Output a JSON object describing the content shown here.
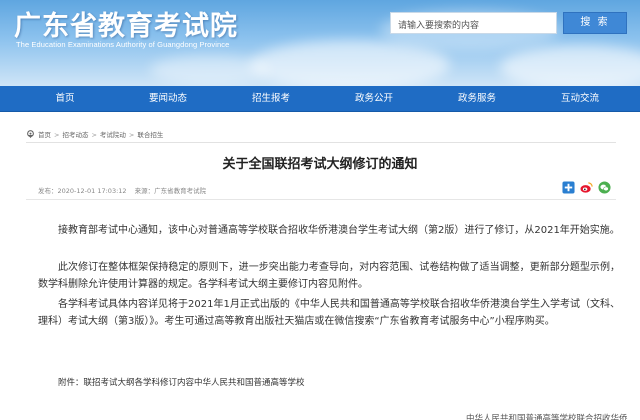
{
  "header": {
    "site_title": "广东省教育考试院",
    "site_subtitle": "The Education Examinations Authority of Guangdong Province",
    "search_placeholder": "请输入要搜索的内容",
    "search_button": "搜 索"
  },
  "nav": {
    "items": [
      {
        "label": "首页"
      },
      {
        "label": "要闻动态"
      },
      {
        "label": "招生报考"
      },
      {
        "label": "政务公开"
      },
      {
        "label": "政务服务"
      },
      {
        "label": "互动交流"
      }
    ]
  },
  "breadcrumb": {
    "items": [
      "首页",
      "招考动态",
      "考试院动",
      "联合招生"
    ]
  },
  "article": {
    "title": "关于全国联招考试大纲修订的通知",
    "publish_time": "发布：2020-12-01 17:03:12",
    "source": "来源：广东省教育考试院",
    "paragraphs": [
      "接教育部考试中心通知，该中心对普通高等学校联合招收华侨港澳台学生考试大纲（第2版）进行了修订，从2021年开始实施。",
      "此次修订在整体框架保持稳定的原则下，进一步突出能力考查导向，对内容范围、试卷结构做了适当调整，更新部分题型示例，数学科删除允许使用计算器的规定。各学科考试大纲主要修订内容见附件。",
      "各学科考试具体内容详见将于2021年1月正式出版的《中华人民共和国普通高等学校联合招收华侨港澳台学生入学考试（文科、理科）考试大纲（第3版）》。考生可通过高等教育出版社天猫店或在微信搜索“广东省教育考试服务中心”小程序购买。"
    ],
    "attachment": "附件：联招考试大纲各学科修订内容中华人民共和国普通高等学校",
    "cut_off_line": "中华人民共和国普通高等学校联合招收华侨"
  },
  "colors": {
    "header_sky": "#5fa6e0",
    "nav_bg": "#1f6cc4",
    "search_button": "#3f88d6"
  },
  "icons": {
    "breadcrumb": "home-icon",
    "share": [
      "add-share-icon",
      "weibo-icon",
      "wechat-icon"
    ]
  }
}
